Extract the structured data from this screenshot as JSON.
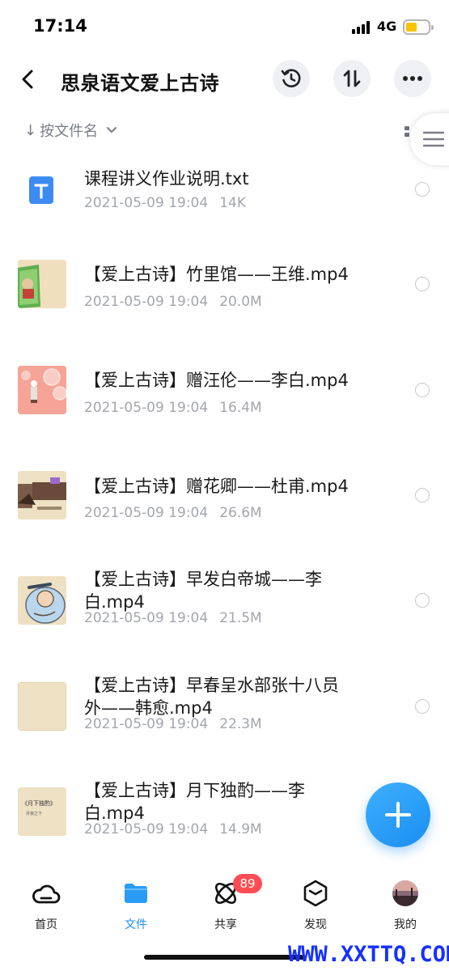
{
  "status": {
    "time": "17:14",
    "network": "4G"
  },
  "header": {
    "title": "思泉语文爱上古诗",
    "icons": [
      "back-arrow-icon",
      "history-icon",
      "transfer-icon",
      "more-icon"
    ]
  },
  "sort": {
    "label": "按文件名",
    "arrow": "↓"
  },
  "files": [
    {
      "name": "课程讲义作业说明.txt",
      "date": "2021-05-09 19:04",
      "size": "14K",
      "thumb": "txt"
    },
    {
      "name": "【爱上古诗】竹里馆——王维.mp4",
      "date": "2021-05-09 19:04",
      "size": "20.0M",
      "thumb": "video-1"
    },
    {
      "name": "【爱上古诗】赠汪伦——李白.mp4",
      "date": "2021-05-09 19:04",
      "size": "16.4M",
      "thumb": "video-2"
    },
    {
      "name": "【爱上古诗】赠花卿——杜甫.mp4",
      "date": "2021-05-09 19:04",
      "size": "26.6M",
      "thumb": "video-3"
    },
    {
      "name": "【爱上古诗】早发白帝城——李白.mp4",
      "date": "2021-05-09 19:04",
      "size": "21.5M",
      "thumb": "video-4"
    },
    {
      "name": "【爱上古诗】早春呈水部张十八员外——韩愈.mp4",
      "date": "2021-05-09 19:04",
      "size": "22.3M",
      "thumb": "video-5"
    },
    {
      "name": "【爱上古诗】月下独酌——李白.mp4",
      "date": "2021-05-09 19:04",
      "size": "14.9M",
      "thumb": "video-6"
    }
  ],
  "thumb_texts": {
    "video6_title": "《月下独酌》",
    "video6_sub": "月夜之下"
  },
  "nav": {
    "items": [
      {
        "label": "首页",
        "icon": "cloud-icon"
      },
      {
        "label": "文件",
        "icon": "folder-icon"
      },
      {
        "label": "共享",
        "icon": "share-orbit-icon"
      },
      {
        "label": "发现",
        "icon": "cube-icon"
      },
      {
        "label": "我的",
        "icon": "avatar"
      }
    ],
    "active": "文件",
    "share_badge": "89"
  },
  "watermark": "WWW.XXTTQ.COM",
  "colors": {
    "accent": "#1a8ef0",
    "badge": "#ff4d55",
    "meta": "#a3a6ad"
  }
}
